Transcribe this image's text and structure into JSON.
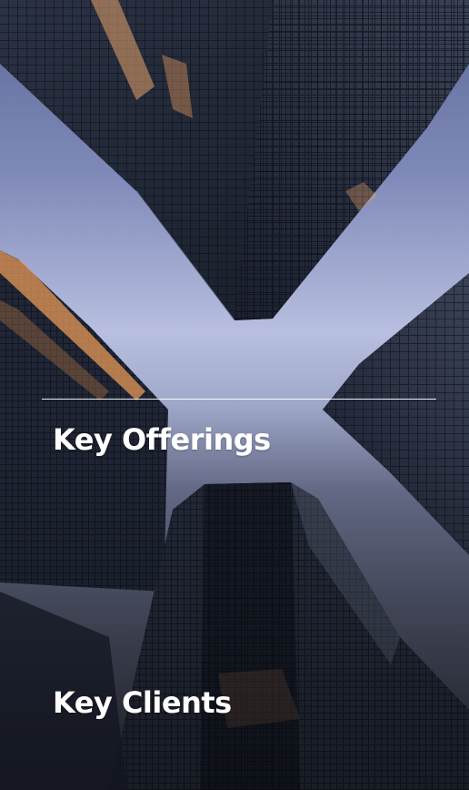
{
  "sections": {
    "offerings": {
      "title": "Key Offerings"
    },
    "clients": {
      "title": "Key Clients"
    }
  },
  "colors": {
    "sky_top": "#5d6a99",
    "sky_mid": "#b8bfe0",
    "glass_dark": "#1d2330",
    "window_glow": "#e7a46b",
    "text": "#ffffff"
  }
}
